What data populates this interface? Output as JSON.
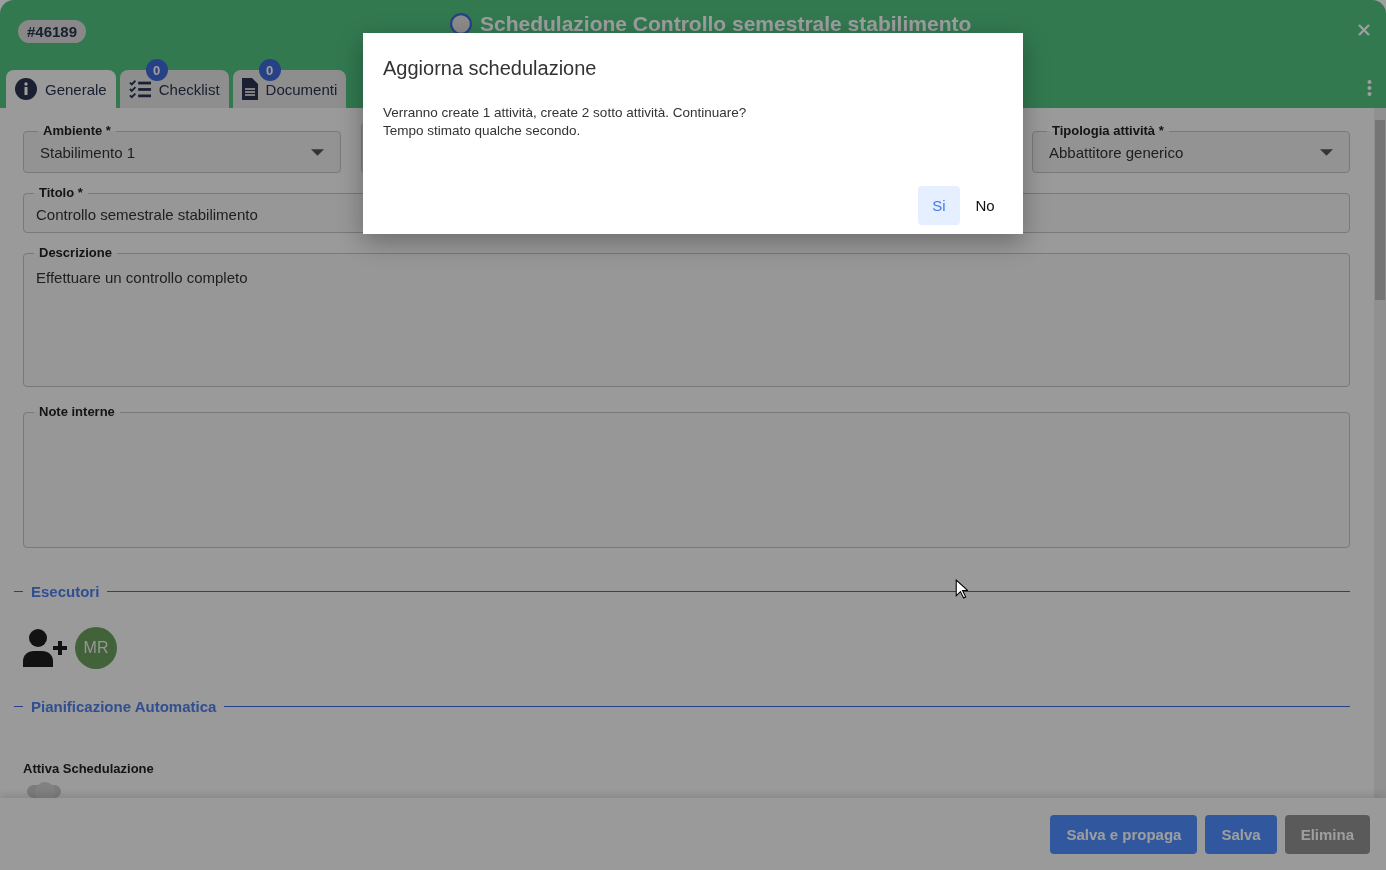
{
  "window": {
    "id_badge": "#46189",
    "title": "Schedulazione Controllo semestrale stabilimento"
  },
  "tabs": [
    {
      "label": "Generale",
      "kind": "info",
      "selected": true
    },
    {
      "label": "Checklist",
      "kind": "checklist",
      "badge": "0",
      "selected": false
    },
    {
      "label": "Documenti",
      "kind": "document",
      "badge": "0",
      "selected": false
    }
  ],
  "fields": {
    "ambiente": {
      "label": "Ambiente *",
      "value": "Stabilimento 1"
    },
    "tipologia": {
      "label": "Tipologia attività *",
      "value": "Abbattitore generico"
    },
    "titolo": {
      "label": "Titolo *",
      "value": "Controllo semestrale stabilimento"
    },
    "descrizione": {
      "label": "Descrizione",
      "value": "Effettuare un controllo completo"
    },
    "note": {
      "label": "Note interne"
    }
  },
  "esecutori": {
    "heading": "Esecutori",
    "avatars": [
      {
        "initials": "MR"
      }
    ]
  },
  "pianificazione": {
    "heading": "Pianificazione Automatica",
    "switch_label": "Attiva Schedulazione",
    "on": false
  },
  "footer_buttons": [
    {
      "label": "Salva e propaga",
      "kind": "primary"
    },
    {
      "label": "Salva",
      "kind": "primary"
    },
    {
      "label": "Elimina",
      "kind": "danger"
    }
  ],
  "dialog": {
    "title": "Aggiorna schedulazione",
    "lines": [
      "Verranno create 1 attività, create 2 sotto attività. Continuare?",
      "Tempo stimato qualche secondo."
    ],
    "buttons": [
      {
        "label": "Si",
        "selected": true
      },
      {
        "label": "No",
        "selected": false
      }
    ]
  }
}
